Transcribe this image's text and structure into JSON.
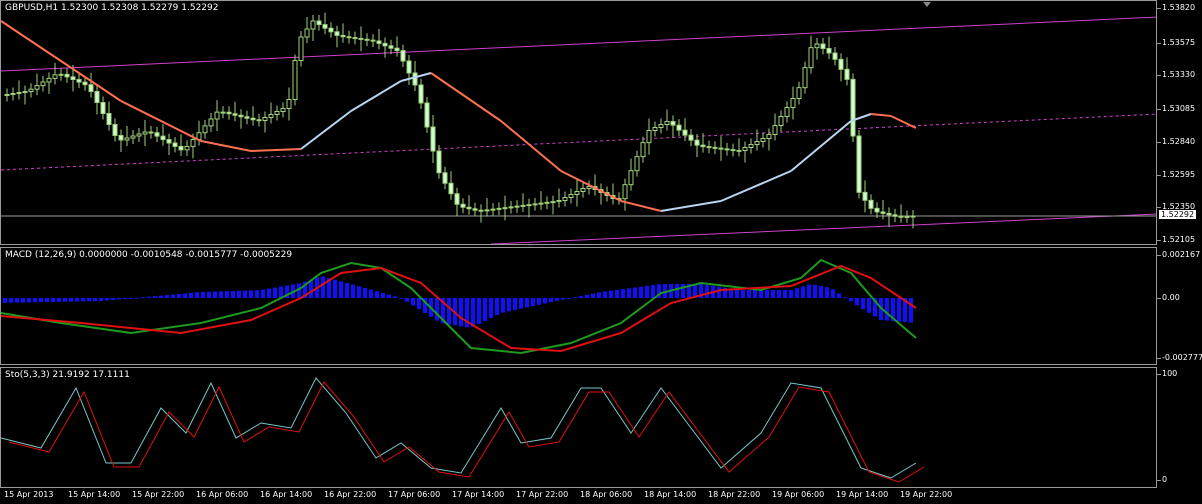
{
  "symbol_header": "GBPUSD,H1  1.52300 1.52308 1.52279 1.52292",
  "macd_header": "MACD  (12,26,9) 0.0000000 -0.0010548 -0.0015777 -0.0005229",
  "sto_header": "Sto(5,3,3) 21.9192 17.1111",
  "price_ticks": [
    "1.53820",
    "1.53575",
    "1.53330",
    "1.53085",
    "1.52840",
    "1.52595",
    "1.52350",
    "1.52105"
  ],
  "current_price": "1.52292",
  "macd_ticks": [
    "0.002167",
    "0.00",
    "-0.002777"
  ],
  "sto_ticks": [
    "100",
    "0"
  ],
  "time_labels": [
    "15 Apr 2013",
    "15 Apr 14:00",
    "15 Apr 22:00",
    "16 Apr 06:00",
    "16 Apr 14:00",
    "16 Apr 22:00",
    "17 Apr 06:00",
    "17 Apr 14:00",
    "17 Apr 22:00",
    "18 Apr 06:00",
    "18 Apr 14:00",
    "18 Apr 22:00",
    "19 Apr 06:00",
    "19 Apr 14:00",
    "19 Apr 22:00"
  ],
  "colors": {
    "candle_bull": "#ccffcc",
    "candle_bear": "#9fd07a",
    "ma_up": "#b8d4f0",
    "ma_down": "#ff7050",
    "channel": "#d040d0",
    "macd_hist": "#1010ff",
    "macd_main": "#1e9a1e",
    "macd_signal": "#e01010",
    "sto_main": "#78c8c8",
    "sto_signal": "#e01010"
  }
}
